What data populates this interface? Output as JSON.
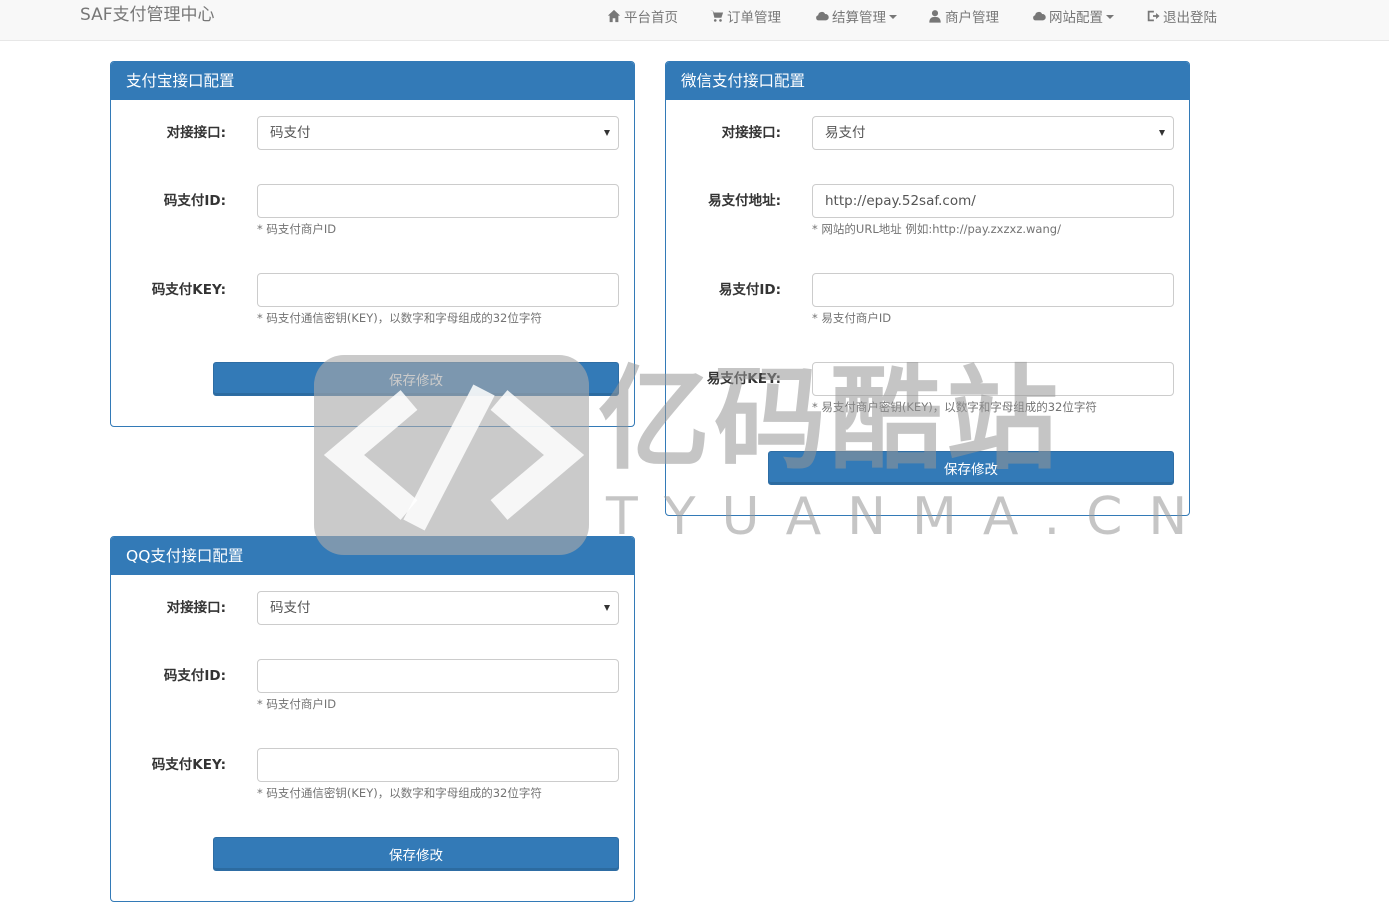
{
  "navbar": {
    "brand": "SAF支付管理中心",
    "items": [
      {
        "label": "平台首页",
        "icon": "home-icon"
      },
      {
        "label": "订单管理",
        "icon": "cart-icon"
      },
      {
        "label": "结算管理",
        "icon": "cloud-icon",
        "dropdown": true
      },
      {
        "label": "商户管理",
        "icon": "user-icon"
      },
      {
        "label": "网站配置",
        "icon": "cloud-icon",
        "dropdown": true
      },
      {
        "label": "退出登陆",
        "icon": "logout-icon"
      }
    ]
  },
  "alipay": {
    "title": "支付宝接口配置",
    "interface_label": "对接接口:",
    "interface_value": "码支付",
    "id_label": "码支付ID:",
    "id_value": "",
    "id_help": "* 码支付商户ID",
    "key_label": "码支付KEY:",
    "key_value": "",
    "key_help": "* 码支付通信密钥(KEY)，以数字和字母组成的32位字符",
    "save_label": "保存修改"
  },
  "wechat": {
    "title": "微信支付接口配置",
    "interface_label": "对接接口:",
    "interface_value": "易支付",
    "url_label": "易支付地址:",
    "url_value": "http://epay.52saf.com/",
    "url_help": "* 网站的URL地址 例如:http://pay.zxzxz.wang/",
    "id_label": "易支付ID:",
    "id_value": "",
    "id_help": "* 易支付商户ID",
    "key_label": "易支付KEY:",
    "key_value": "",
    "key_help": "* 易支付商户密钥(KEY)，以数字和字母组成的32位字符",
    "save_label": "保存修改"
  },
  "qq": {
    "title": "QQ支付接口配置",
    "interface_label": "对接接口:",
    "interface_value": "码支付",
    "id_label": "码支付ID:",
    "id_value": "",
    "id_help": "* 码支付商户ID",
    "key_label": "码支付KEY:",
    "key_value": "",
    "key_help": "* 码支付通信密钥(KEY)，以数字和字母组成的32位字符",
    "save_label": "保存修改"
  },
  "watermark": {
    "cn": "亿码酷站",
    "en": "TYUANMA.CN"
  },
  "colors": {
    "primary": "#337ab7",
    "navbar_bg": "#f8f8f8",
    "nav_text": "#777777"
  }
}
